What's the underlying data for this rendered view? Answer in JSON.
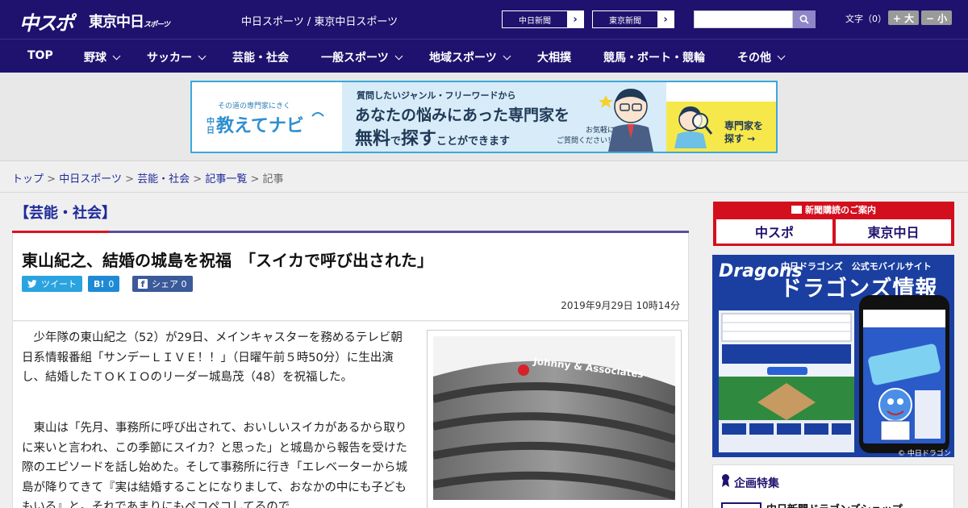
{
  "header": {
    "logo_chuspo": "中スポ",
    "logo_tokyo": "東京中日",
    "logo_tokyo_suffix": "スポーツ",
    "site_name": "中日スポーツ / 東京中日スポーツ",
    "paper_buttons": [
      {
        "label": "中日新聞",
        "arrow": "›"
      },
      {
        "label": "東京新聞",
        "arrow": "›"
      }
    ],
    "search": {
      "placeholder": "",
      "icon": "search-icon"
    },
    "font_size": {
      "label": "文字（0）",
      "larger": "+ 大",
      "smaller": "− 小"
    }
  },
  "nav": {
    "items": [
      {
        "label": "TOP",
        "has_menu": false
      },
      {
        "label": "野球",
        "has_menu": true
      },
      {
        "label": "サッカー",
        "has_menu": true
      },
      {
        "label": "芸能・社会",
        "has_menu": false
      },
      {
        "label": "一般スポーツ",
        "has_menu": true
      },
      {
        "label": "地域スポーツ",
        "has_menu": true
      },
      {
        "label": "大相撲",
        "has_menu": false
      },
      {
        "label": "競馬・ボート・競輪",
        "has_menu": false
      },
      {
        "label": "その他",
        "has_menu": true
      }
    ]
  },
  "ad": {
    "tagline": "その道の専門家にきく",
    "logo_prefix": "中日",
    "logo": "教えてナビ",
    "line1": "質問したいジャンル・フリーワードから",
    "line2": "あなたの悩みにあった専門家を",
    "line3_a": "無料",
    "line3_b": "で",
    "line3_c": "探す",
    "line3_d": "ことができます",
    "note1": "お気軽に",
    "note2": "ご質問ください！",
    "cta1": "専門家を",
    "cta2": "探す →",
    "colors": {
      "border": "#3aa8dc",
      "mid": "#d7ecf8",
      "cta": "#f6e84a"
    }
  },
  "breadcrumb": {
    "items": [
      "トップ",
      "中日スポーツ",
      "芸能・社会",
      "記事一覧"
    ],
    "current": "記事",
    "separator": ">"
  },
  "article": {
    "category": "【芸能・社会】",
    "headline": "東山紀之、結婚の城島を祝福　「スイカで呼び出された」",
    "share": {
      "tweet": "ツイート",
      "hatena_icon": "B!",
      "hatena_count": "0",
      "facebook_icon": "f",
      "facebook_label": "シェア",
      "facebook_count": "0"
    },
    "date": "2019年9月29日 10時14分",
    "paragraphs": [
      "少年隊の東山紀之（52）が29日、メインキャスターを務めるテレビ朝日系情報番組「サンデーＬＩＶＥ！！」（日曜午前５時50分）に生出演し、結婚したＴＯＫＩＯのリーダー城島茂（48）を祝福した。",
      "東山は「先月、事務所に呼び出されて、おいしいスイカがあるから取りに来いと言われ、この季節にスイカ？と思った」と城島から報告を受けた際のエピソードを話し始めた。そして事務所に行き「エレベーターから城島が降りてきて『実は結婚することになりまして、おなかの中にも子どももいる』と。それであまりにもペコペコしてるので…"
    ],
    "photo_sign": "Johnny & Associates"
  },
  "sidebar": {
    "subscribe_title": "新聞購読のご案内",
    "subscribe_buttons": [
      {
        "label": "中スポ"
      },
      {
        "label": "東京中日"
      }
    ],
    "dragons": {
      "logo": "Dragons",
      "subtitle": "中日ドラゴンズ　公式モバイルサイト",
      "title": "ドラゴンズ情報",
      "copyright": "© 中日ドラゴンズ"
    },
    "feature": {
      "title": "企画特集",
      "item": "中日新聞ドラゴンズショップ"
    }
  }
}
